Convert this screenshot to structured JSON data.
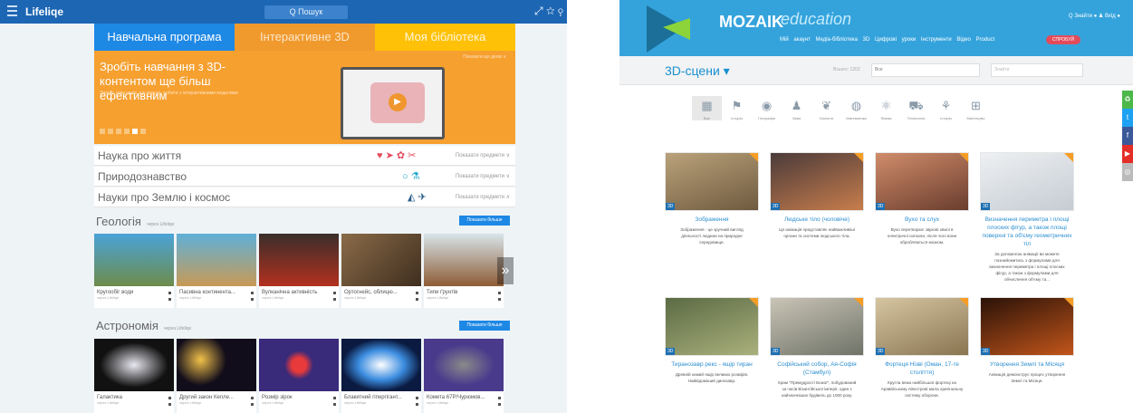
{
  "left": {
    "app_title": "Lifeliqe",
    "search_placeholder": "Q  Пошук",
    "top_icons": "⤢ ☆ ⚲",
    "tabs": [
      "Навчальна програма",
      "Інтерактивне 3D",
      "Моя бібліотека"
    ],
    "banner": {
      "headline": "Зробіть навчання з 3D-контентом ще більш ефективним",
      "subtitle": "Змініть уяву учнів, що можуть робити з інтерактивними моделями",
      "link": "Показати ще деякі  ∨"
    },
    "categories": [
      {
        "name": "Наука про життя",
        "icons": "♥ ➤ ✿ ✂",
        "action": "Показати предмети ∨"
      },
      {
        "name": "Природознавство",
        "icons": "○ ⚗",
        "action": "Показати предмети ∨"
      },
      {
        "name": "Науки про Землю і космос",
        "icons": "◭ ✈",
        "action": "Показати предмети ∧"
      }
    ],
    "geology": {
      "title": "Геологія",
      "by": "через Lifeliqe",
      "more": "Показати більше",
      "cards": [
        {
          "caption": "Кругообіг води",
          "sub": "через Lifeliqe"
        },
        {
          "caption": "Пасивна континента...",
          "sub": "через Lifeliqe"
        },
        {
          "caption": "Вулканічна активність",
          "sub": "через Lifeliqe"
        },
        {
          "caption": "Ортогнейс, облицю...",
          "sub": "через Lifeliqe"
        },
        {
          "caption": "Типи ґрунтів",
          "sub": "через Lifeliqe"
        }
      ]
    },
    "astronomy": {
      "title": "Астрономія",
      "by": "через Lifeliqe",
      "more": "Показати більше",
      "cards": [
        {
          "caption": "Галактика",
          "sub": "через Lifeliqe"
        },
        {
          "caption": "Другий закон Кепле...",
          "sub": "через Lifeliqe"
        },
        {
          "caption": "Розмір зірок",
          "sub": "через Lifeliqe"
        },
        {
          "caption": "Блакитний гіпергігант...",
          "sub": "через Lifeliqe"
        },
        {
          "caption": "Комета 67P/Чурюмов...",
          "sub": "через Lifeliqe"
        }
      ]
    },
    "arrow": "»"
  },
  "right": {
    "brand": "MOZAIK",
    "brand2": "education",
    "top_right": "Q Знайти   ●   ♟ Вхід   ●",
    "menu": [
      "Мій акаунт",
      "Медіа-бібліотека",
      "3D",
      "Цифрові уроки",
      "Інструменти",
      "Відео",
      "Product"
    ],
    "promo": "СПРОБУЙ",
    "scenes_title": "3D-сцени ▾",
    "count": "Всього: 1202",
    "select_value": "Все",
    "search_placeholder": "Знайти",
    "cat_icons": [
      {
        "glyph": "▦",
        "label": "Все"
      },
      {
        "glyph": "⚑",
        "label": "Історія"
      },
      {
        "glyph": "◉",
        "label": "Географія"
      },
      {
        "glyph": "♟",
        "label": "Хімія"
      },
      {
        "glyph": "❦",
        "label": "Біологія"
      },
      {
        "glyph": "◍",
        "label": "Математика"
      },
      {
        "glyph": "⚛",
        "label": "Фізика"
      },
      {
        "glyph": "⛟",
        "label": "Технологія"
      },
      {
        "glyph": "⚘",
        "label": "Історія"
      },
      {
        "glyph": "⊞",
        "label": "Мистецтво"
      }
    ],
    "cards": [
      {
        "title": "Зображення",
        "desc": "Зображення - це зручний вигляд діяльності людини на природне середовище.",
        "grad": "#b9a27a,#6f5a3f"
      },
      {
        "title": "Людське тіло (чоловіче)",
        "desc": "Ця анімація представляє найважливіші органи та системи людського тіла.",
        "grad": "#4b3b3a,#c87d4c"
      },
      {
        "title": "Вухо та слух",
        "desc": "Вухо перетворює звукові хвилі в електричні сигнали, після чого вони обробляються мозком.",
        "grad": "#d08c6a,#6a3d2e"
      },
      {
        "title": "Визначення периметра і площі плоских фігур, а також площі поверхні та об'єму геометричних тіл",
        "desc": "За допомогою анімації ви можете познайомитись з формулами для визначення периметра і площі плоских фігур, а також з формулами для обчислення об'єму та...",
        "grad": "#eef0f2,#c5ccd3"
      },
      {
        "title": "Тиранозавр рекс - ящір тиран",
        "desc": "Древній хижий ящір великих розмірів. Найвідоміший динозавр.",
        "grad": "#5b6b44,#aab07c"
      },
      {
        "title": "Софійський собор, Ая-Софія (Стамбул)",
        "desc": "Храм \"Премудрості Божої\", побудований за часів Візантійської імперії, один з найзначніших будівель до 1000 року.",
        "grad": "#c9c4b6,#6f7368"
      },
      {
        "title": "Фортеця Нізві (Оман, 17-те століття)",
        "desc": "Кругла вежа найбільшої фортеці на Аравійському півострові мала оригінальну систему оборони.",
        "grad": "#d6c5a1,#8a7551"
      },
      {
        "title": "Утворення Землі та Місяця",
        "desc": "Анімація демонструє процес утворення Землі та Місяця.",
        "grad": "#2a1208,#c2551a"
      }
    ],
    "badge": "3D",
    "social": [
      "♻",
      "t",
      "f",
      "▶",
      "◎"
    ]
  },
  "colors": {
    "blue": "#1e88e5",
    "orange": "#f6a030",
    "yellow": "#ffc107",
    "mozaik_blue": "#34a3dc",
    "link": "#2a8ed0"
  }
}
